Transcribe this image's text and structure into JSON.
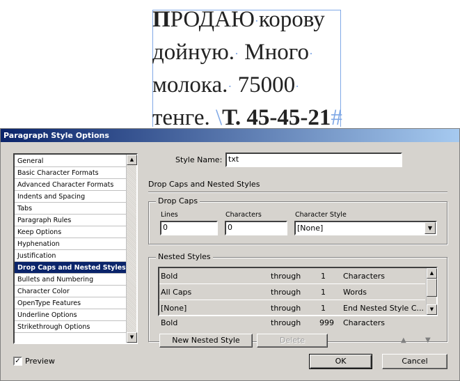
{
  "document": {
    "line1_bold": "П",
    "line1_rest": "РОДАЮ",
    "line1_end": "корову",
    "line2_a": "дойную.",
    "line2_b": "Много",
    "line3_a": "молока.",
    "line3_b": "75000",
    "line4_a": "тенге.",
    "line4_b": "Т. 45-45-21",
    "hidden_char": "·",
    "paragraph_mark": "#",
    "tab_mark": "\\"
  },
  "dialog": {
    "title": "Paragraph Style Options",
    "style_name_label": "Style Name:",
    "style_name_value": "txt",
    "section_title": "Drop Caps and Nested Styles",
    "categories": [
      {
        "label": "General",
        "selected": false
      },
      {
        "label": "Basic Character Formats",
        "selected": false
      },
      {
        "label": "Advanced Character Formats",
        "selected": false
      },
      {
        "label": "Indents and Spacing",
        "selected": false
      },
      {
        "label": "Tabs",
        "selected": false
      },
      {
        "label": "Paragraph Rules",
        "selected": false
      },
      {
        "label": "Keep Options",
        "selected": false
      },
      {
        "label": "Hyphenation",
        "selected": false
      },
      {
        "label": "Justification",
        "selected": false
      },
      {
        "label": "Drop Caps and Nested Styles",
        "selected": true
      },
      {
        "label": "Bullets and Numbering",
        "selected": false
      },
      {
        "label": "Character Color",
        "selected": false
      },
      {
        "label": "OpenType Features",
        "selected": false
      },
      {
        "label": "Underline Options",
        "selected": false
      },
      {
        "label": "Strikethrough Options",
        "selected": false
      }
    ],
    "drop_caps": {
      "group_title": "Drop Caps",
      "lines_label": "Lines",
      "lines_value": "0",
      "characters_label": "Characters",
      "characters_value": "0",
      "char_style_label": "Character Style",
      "char_style_value": "[None]"
    },
    "nested_styles": {
      "group_title": "Nested Styles",
      "rows": [
        {
          "style": "Bold",
          "mode": "through",
          "count": "1",
          "unit": "Characters"
        },
        {
          "style": "All Caps",
          "mode": "through",
          "count": "1",
          "unit": "Words"
        },
        {
          "style": "[None]",
          "mode": "through",
          "count": "1",
          "unit": "End Nested Style C..."
        }
      ],
      "extra_row": {
        "style": "Bold",
        "mode": "through",
        "count": "999",
        "unit": "Characters"
      },
      "new_button": "New Nested Style",
      "delete_button": "Delete"
    },
    "preview_label": "Preview",
    "preview_checked": true,
    "ok_label": "OK",
    "cancel_label": "Cancel"
  },
  "colors": {
    "titlebar_start": "#0a246a",
    "titlebar_end": "#a6caf0",
    "selection": "#0a246a",
    "dialog_bg": "#d6d3ce",
    "frame_guide": "#7fa8e6"
  }
}
